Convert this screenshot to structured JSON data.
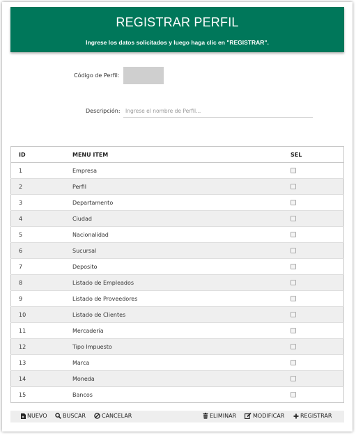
{
  "header": {
    "title": "REGISTRAR PERFIL",
    "subtitle": "Ingrese los datos solicitados y luego haga clic en \"REGISTRAR\"."
  },
  "form": {
    "code_label": "Código de Perfil:",
    "code_value": "",
    "desc_label": "Descripción:",
    "desc_placeholder": "Ingrese el nombre de Perfil...",
    "desc_value": ""
  },
  "table": {
    "columns": [
      "ID",
      "MENU ITEM",
      "SEL"
    ],
    "rows": [
      {
        "id": "1",
        "item": "Empresa",
        "selected": false
      },
      {
        "id": "2",
        "item": "Perfil",
        "selected": false
      },
      {
        "id": "3",
        "item": "Departamento",
        "selected": false
      },
      {
        "id": "4",
        "item": "Ciudad",
        "selected": false
      },
      {
        "id": "5",
        "item": "Nacionalidad",
        "selected": false
      },
      {
        "id": "6",
        "item": "Sucursal",
        "selected": false
      },
      {
        "id": "7",
        "item": "Deposito",
        "selected": false
      },
      {
        "id": "8",
        "item": "Listado de Empleados",
        "selected": false
      },
      {
        "id": "9",
        "item": "Listado de Proveedores",
        "selected": false
      },
      {
        "id": "10",
        "item": "Listado de Clientes",
        "selected": false
      },
      {
        "id": "11",
        "item": "Mercadería",
        "selected": false
      },
      {
        "id": "12",
        "item": "Tipo Impuesto",
        "selected": false
      },
      {
        "id": "13",
        "item": "Marca",
        "selected": false
      },
      {
        "id": "14",
        "item": "Moneda",
        "selected": false
      },
      {
        "id": "15",
        "item": "Bancos",
        "selected": false
      }
    ]
  },
  "toolbar": {
    "nuevo": "NUEVO",
    "buscar": "BUSCAR",
    "cancelar": "CANCELAR",
    "eliminar": "ELIMINAR",
    "modificar": "MODIFICAR",
    "registrar": "REGISTRAR"
  },
  "colors": {
    "header_bg": "#00775a",
    "row_alt_bg": "#efefef",
    "toolbar_bg": "#eeeeee"
  }
}
